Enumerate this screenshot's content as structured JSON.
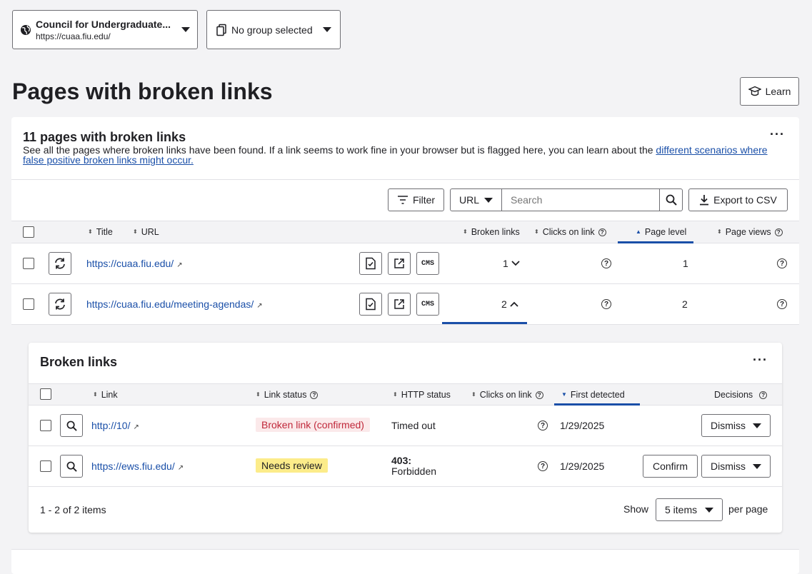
{
  "site_select": {
    "name": "Council for Undergraduate...",
    "url": "https://cuaa.fiu.edu/"
  },
  "group_select": {
    "label": "No group selected"
  },
  "page_title": "Pages with broken links",
  "learn_button": "Learn",
  "summary": {
    "title": "11 pages with broken links",
    "description": "See all the pages where broken links have been found. If a link seems to work fine in your browser but is flagged here, you can learn about the ",
    "link_text": "different scenarios where false positive broken links might occur."
  },
  "toolbar": {
    "filter_label": "Filter",
    "search_field": "URL",
    "search_placeholder": "Search",
    "export_label": "Export to CSV"
  },
  "pages_table": {
    "columns": {
      "title": "Title",
      "url": "URL",
      "broken_links": "Broken links",
      "clicks": "Clicks on link",
      "page_level": "Page level",
      "page_views": "Page views"
    },
    "rows": [
      {
        "url": "https://cuaa.fiu.edu/",
        "broken_links": "1",
        "page_level": "1"
      },
      {
        "url": "https://cuaa.fiu.edu/meeting-agendas/",
        "broken_links": "2",
        "page_level": "2"
      }
    ],
    "cms_label": "CMS"
  },
  "broken_links": {
    "title": "Broken links",
    "columns": {
      "link": "Link",
      "link_status": "Link status",
      "http_status": "HTTP status",
      "clicks": "Clicks on link",
      "first_detected": "First detected",
      "decisions": "Decisions"
    },
    "rows": [
      {
        "link": "http://10/",
        "status": "Broken link (confirmed)",
        "http_code": "",
        "http_text": "Timed out",
        "first_detected": "1/29/2025",
        "dismiss": "Dismiss"
      },
      {
        "link": "https://ews.fiu.edu/",
        "status": "Needs review",
        "http_code": "403:",
        "http_text": "Forbidden",
        "first_detected": "1/29/2025",
        "confirm": "Confirm",
        "dismiss": "Dismiss"
      }
    ],
    "pagination": {
      "summary": "1 - 2 of 2 items",
      "show_label": "Show",
      "per_page_value": "5 items",
      "per_page_label": "per page"
    }
  },
  "colors": {
    "accent": "#1a4fa8",
    "broken_bg": "#fbe9ea",
    "broken_text": "#c0283a",
    "review_bg": "#fcec8a"
  }
}
